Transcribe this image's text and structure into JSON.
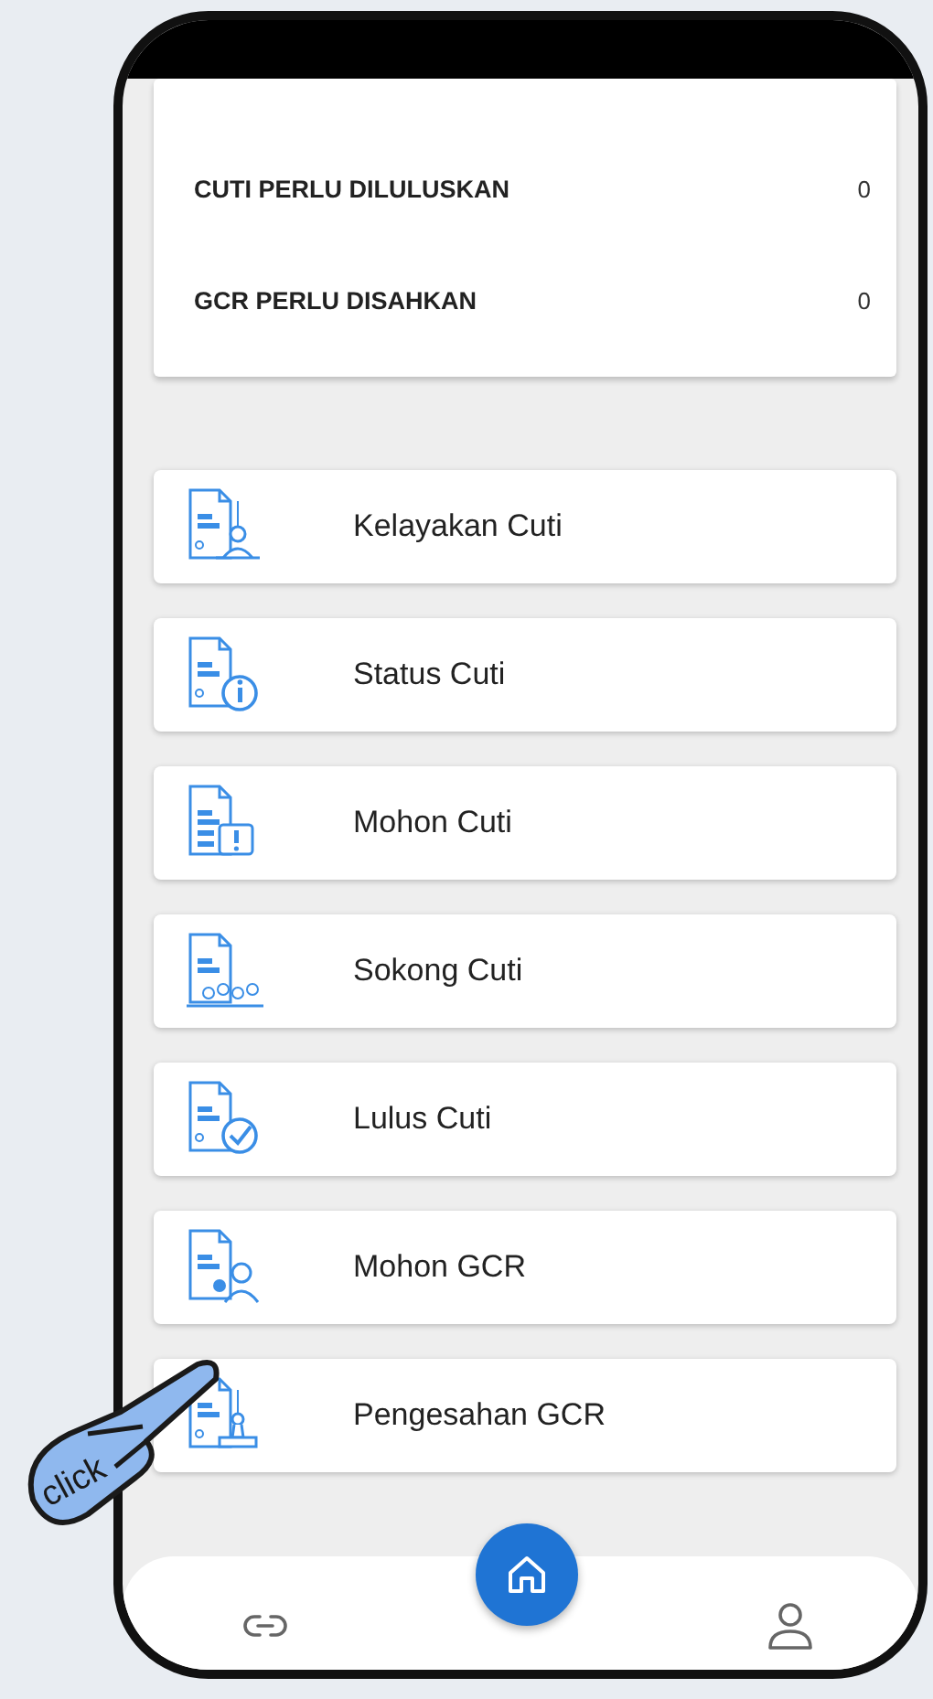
{
  "summary": {
    "rows": [
      {
        "label": "CUTI PERLU DILULUSKAN",
        "count": "0"
      },
      {
        "label": "GCR PERLU DISAHKAN",
        "count": "0"
      }
    ]
  },
  "menu": [
    {
      "label": "Kelayakan Cuti",
      "kind": "eligibility"
    },
    {
      "label": "Status Cuti",
      "kind": "status"
    },
    {
      "label": "Mohon Cuti",
      "kind": "apply"
    },
    {
      "label": "Sokong Cuti",
      "kind": "support"
    },
    {
      "label": "Lulus Cuti",
      "kind": "approve"
    },
    {
      "label": "Mohon GCR",
      "kind": "gcr_apply"
    },
    {
      "label": "Pengesahan GCR",
      "kind": "stamp"
    }
  ],
  "nav": [
    {
      "kind": "link"
    },
    {
      "kind": "home"
    },
    {
      "kind": "profile"
    }
  ],
  "annotation": {
    "label": "click"
  }
}
